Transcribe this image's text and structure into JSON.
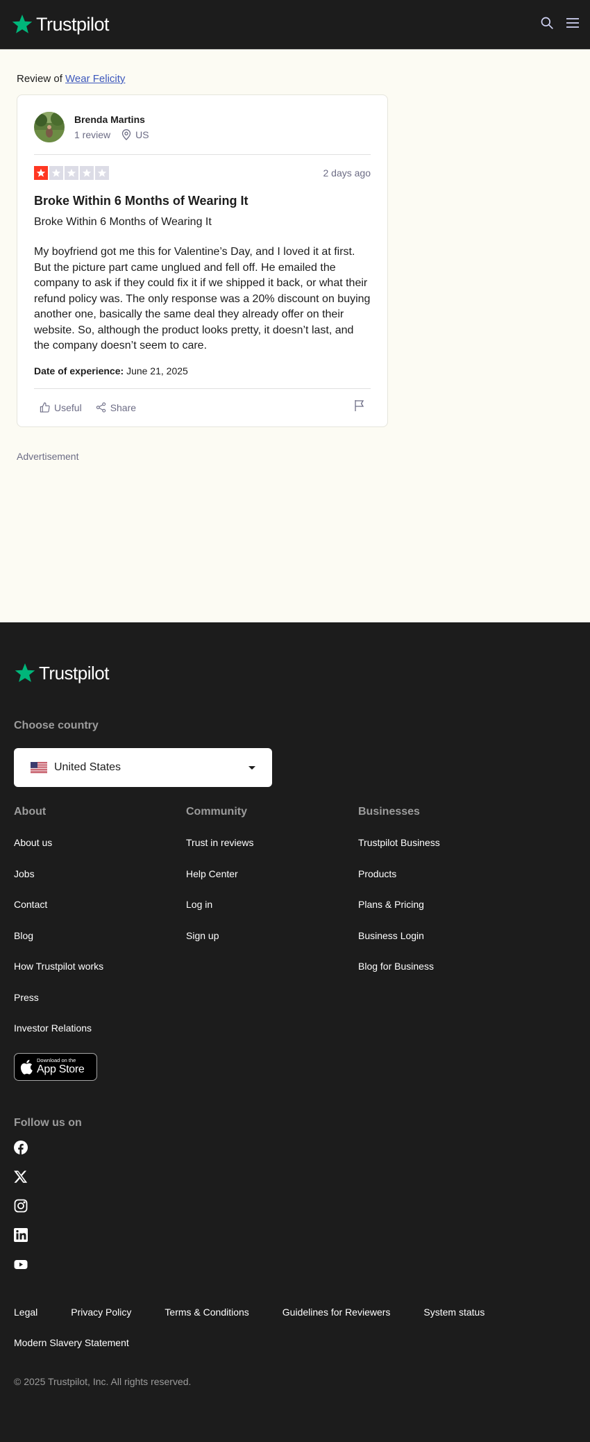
{
  "header": {
    "brand": "Trustpilot"
  },
  "review_of": {
    "prefix": "Review of",
    "company": "Wear Felicity"
  },
  "reviewer": {
    "name": "Brenda Martins",
    "review_count": "1 review",
    "country": "US"
  },
  "review": {
    "rating": 1,
    "max_rating": 5,
    "star_color": "#ff3722",
    "empty_star_color": "#dcdce6",
    "date_ago": "2 days ago",
    "title": "Broke Within 6 Months of Wearing It",
    "subtitle": "Broke Within 6 Months of Wearing It",
    "body": "My boyfriend got me this for Valentine’s Day, and I loved it at first. But the picture part came unglued and fell off. He emailed the company to ask if they could fix it if we shipped it back, or what their refund policy was. The only response was a 20% discount on buying another one, basically the same deal they already offer on their website. So, although the product looks pretty, it doesn’t last, and the company doesn’t seem to care.",
    "experience_label": "Date of experience:",
    "experience_date": "June 21, 2025"
  },
  "actions": {
    "useful": "Useful",
    "share": "Share"
  },
  "advertisement": "Advertisement",
  "footer": {
    "brand": "Trustpilot",
    "brand_color": "#00b67a",
    "choose_country": "Choose country",
    "country": "United States",
    "columns": [
      {
        "title": "About",
        "links": [
          "About us",
          "Jobs",
          "Contact",
          "Blog",
          "How Trustpilot works",
          "Press",
          "Investor Relations"
        ]
      },
      {
        "title": "Community",
        "links": [
          "Trust in reviews",
          "Help Center",
          "Log in",
          "Sign up"
        ]
      },
      {
        "title": "Businesses",
        "links": [
          "Trustpilot Business",
          "Products",
          "Plans & Pricing",
          "Business Login",
          "Blog for Business"
        ]
      }
    ],
    "appstore_small": "Download on the",
    "appstore_big": "App Store",
    "follow": "Follow us on",
    "socials": [
      "facebook-icon",
      "x-icon",
      "instagram-icon",
      "linkedin-icon",
      "youtube-icon"
    ],
    "legal": [
      "Legal",
      "Privacy Policy",
      "Terms & Conditions",
      "Guidelines for Reviewers",
      "System status",
      "Modern Slavery Statement"
    ],
    "copyright": "© 2025 Trustpilot, Inc. All rights reserved."
  }
}
